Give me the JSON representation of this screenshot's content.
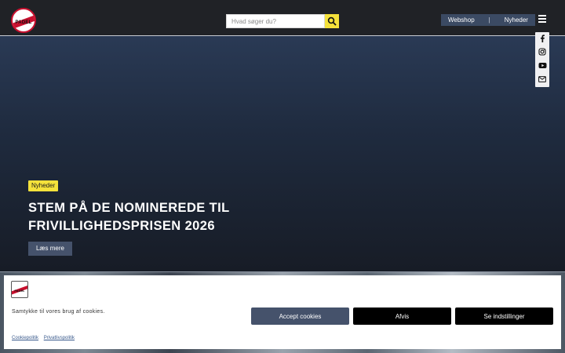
{
  "header": {
    "logo_text": "PADEL",
    "search_placeholder": "Hvad søger du?",
    "nav": [
      {
        "label": "Webshop"
      },
      {
        "label": "Nyheder"
      }
    ],
    "nav_separator": "|"
  },
  "social": [
    "facebook-icon",
    "instagram-icon",
    "youtube-icon",
    "mail-icon"
  ],
  "hero": {
    "category": "Nyheder",
    "headline": "STEM PÅ DE NOMINEREDE TIL FRIVILLIGHEDSPRISEN 2026",
    "cta": "Læs mere"
  },
  "cookie": {
    "logo_text": "PADEL",
    "message": "Samtykke til vores brug af cookies.",
    "accept": "Accept cookies",
    "reject": "Afvis",
    "settings": "Se indstillinger",
    "links": [
      "Cookiepolitik",
      "Privatlivspolitik"
    ]
  },
  "colors": {
    "accent_yellow": "#f5e23b",
    "nav_blue": "#3b4a63",
    "brand_red": "#c8102e"
  }
}
